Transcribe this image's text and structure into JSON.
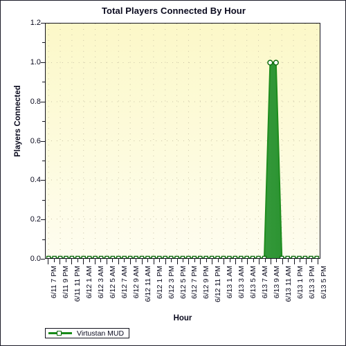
{
  "chart_data": {
    "type": "area",
    "title": "Total Players Connected By Hour",
    "xlabel": "Hour",
    "ylabel": "Players Connected",
    "ylim": [
      0.0,
      1.2
    ],
    "y_ticks": [
      "0.0",
      "0.2",
      "0.4",
      "0.6",
      "0.8",
      "1.0",
      "1.2"
    ],
    "y_tick_values": [
      0.0,
      0.2,
      0.4,
      0.6,
      0.8,
      1.0,
      1.2
    ],
    "grid": true,
    "grid_style": "dotted",
    "legend_position": "bottom-left",
    "series": [
      {
        "name": "Virtustan MUD",
        "color": "#1e8c1e",
        "fill_color": "#2e9e3e",
        "marker": "circle",
        "x": [
          "6/11 7 PM",
          "6/11 8 PM",
          "6/11 9 PM",
          "6/11 10 PM",
          "6/11 11 PM",
          "6/12 12 AM",
          "6/12 1 AM",
          "6/12 2 AM",
          "6/12 3 AM",
          "6/12 4 AM",
          "6/12 5 AM",
          "6/12 6 AM",
          "6/12 7 AM",
          "6/12 8 AM",
          "6/12 9 AM",
          "6/12 10 AM",
          "6/12 11 AM",
          "6/12 12 PM",
          "6/12 1 PM",
          "6/12 2 PM",
          "6/12 3 PM",
          "6/12 4 PM",
          "6/12 5 PM",
          "6/12 6 PM",
          "6/12 7 PM",
          "6/12 8 PM",
          "6/12 9 PM",
          "6/12 10 PM",
          "6/12 11 PM",
          "6/13 12 AM",
          "6/13 1 AM",
          "6/13 2 AM",
          "6/13 3 AM",
          "6/13 4 AM",
          "6/13 5 AM",
          "6/13 6 AM",
          "6/13 7 AM",
          "6/13 8 AM",
          "6/13 9 AM",
          "6/13 10 AM",
          "6/13 11 AM",
          "6/13 12 PM",
          "6/13 1 PM",
          "6/13 2 PM",
          "6/13 3 PM",
          "6/13 4 PM",
          "6/13 5 PM"
        ],
        "values": [
          0,
          0,
          0,
          0,
          0,
          0,
          0,
          0,
          0,
          0,
          0,
          0,
          0,
          0,
          0,
          0,
          0,
          0,
          0,
          0,
          0,
          0,
          0,
          0,
          0,
          0,
          0,
          0,
          0,
          0,
          0,
          0,
          0,
          0,
          0,
          0,
          0,
          0,
          1,
          1,
          0,
          0,
          0,
          0,
          0,
          0,
          0
        ]
      }
    ],
    "x_tick_labels": [
      "6/11 7 PM",
      "6/11 9 PM",
      "6/11 11 PM",
      "6/12 1 AM",
      "6/12 3 AM",
      "6/12 5 AM",
      "6/12 7 AM",
      "6/12 9 AM",
      "6/12 11 AM",
      "6/12 1 PM",
      "6/12 3 PM",
      "6/12 5 PM",
      "6/12 7 PM",
      "6/12 9 PM",
      "6/12 11 PM",
      "6/13 1 AM",
      "6/13 3 AM",
      "6/13 5 AM",
      "6/13 7 AM",
      "6/13 9 AM",
      "6/13 11 AM",
      "6/13 1 PM",
      "6/13 3 PM",
      "6/13 5 PM"
    ]
  },
  "legend": {
    "entries": [
      {
        "label": "Virtustan MUD",
        "color": "#1e8c1e"
      }
    ]
  },
  "colors": {
    "series": "#1e8c1e",
    "fill": "#2e9e3e",
    "plot_background_top": "#fcf8c8",
    "plot_background_bottom": "#fefdf0",
    "axis": "#12121c",
    "text": "#0a0a1e"
  }
}
